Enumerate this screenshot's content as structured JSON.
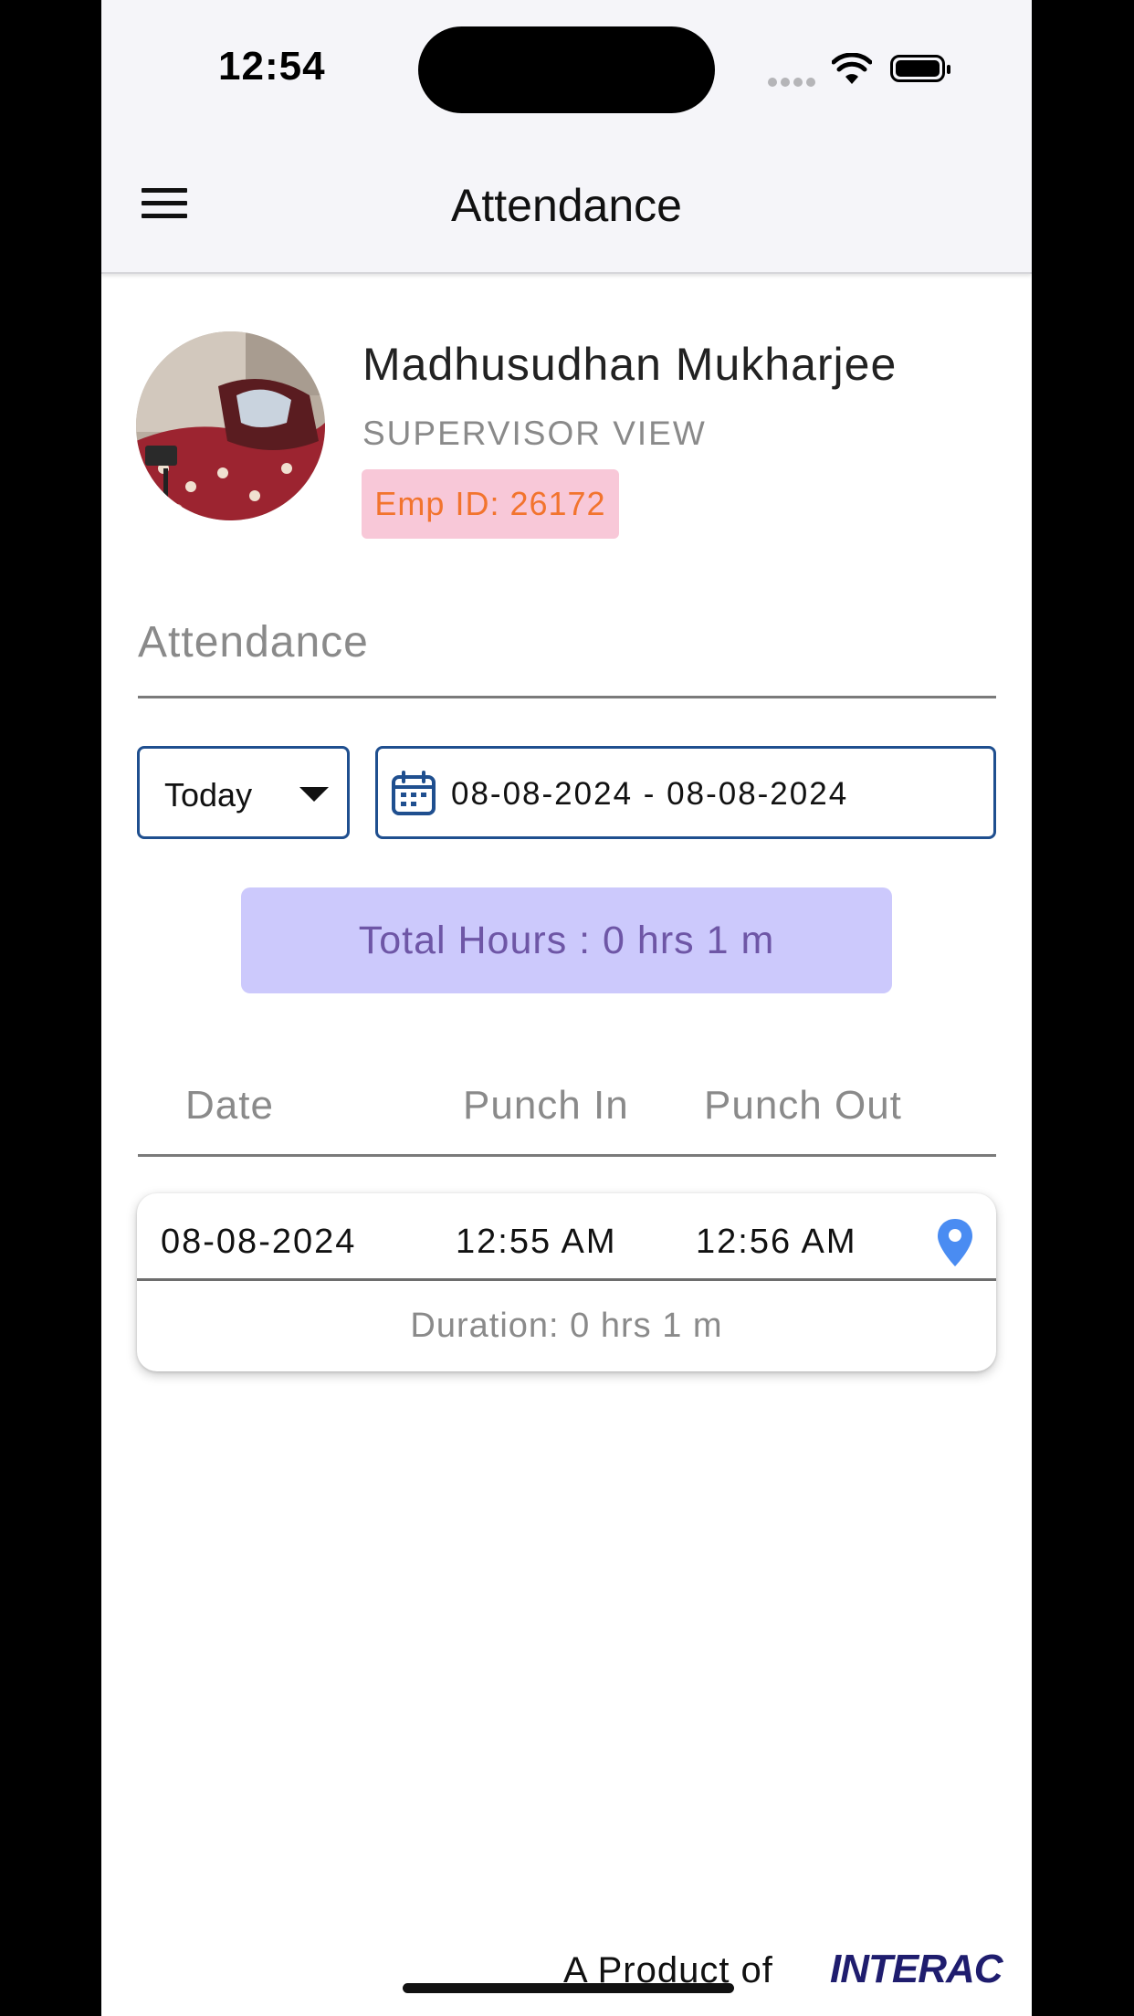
{
  "status_bar": {
    "time": "12:54"
  },
  "app_bar": {
    "title": "Attendance"
  },
  "profile": {
    "name": "Madhusudhan Mukharjee",
    "role": "SUPERVISOR VIEW",
    "emp_id": "Emp ID: 26172"
  },
  "section": {
    "title": "Attendance"
  },
  "filters": {
    "period": "Today",
    "date_range": "08-08-2024 - 08-08-2024"
  },
  "summary": {
    "total_hours": "Total Hours : 0 hrs 1 m"
  },
  "table": {
    "headers": [
      "Date",
      "Punch In",
      "Punch Out"
    ],
    "records": [
      {
        "date": "08-08-2024",
        "punch_in": "12:55 AM",
        "punch_out": "12:56 AM",
        "duration": "Duration: 0 hrs 1 m"
      }
    ]
  },
  "footer": {
    "text": "A Product of",
    "brand": "INTERAC"
  },
  "colors": {
    "accent_border": "#1f4f8f",
    "emp_id_bg": "#f8c8d8",
    "emp_id_text": "#f2742e",
    "total_hours_bg": "#ccc9fc",
    "total_hours_text": "#6e56a6",
    "pin": "#4a8cf2",
    "brand": "#1f1d6e"
  },
  "icons": {
    "menu": "hamburger-icon",
    "calendar": "calendar-icon",
    "dropdown": "caret-down-icon",
    "location": "location-pin-icon"
  }
}
